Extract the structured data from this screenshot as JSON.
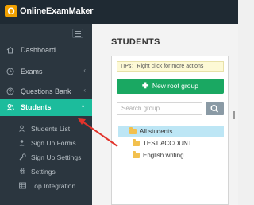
{
  "app": {
    "brand_letter": "O",
    "brand_name": "OnlineExamMaker"
  },
  "sidebar": {
    "items": [
      {
        "label": "Dashboard",
        "icon": "home-icon"
      },
      {
        "label": "Exams",
        "icon": "clock-icon",
        "chevron": "‹"
      },
      {
        "label": "Questions Bank",
        "icon": "question-icon",
        "chevron": "‹"
      },
      {
        "label": "Students",
        "icon": "users-icon",
        "chevron": "⌄",
        "active": true
      }
    ],
    "sub_items": [
      {
        "label": "Students List",
        "icon": "user-list-icon"
      },
      {
        "label": "Sign Up Forms",
        "icon": "user-plus-icon"
      },
      {
        "label": "Sign Up Settings",
        "icon": "wrench-icon"
      },
      {
        "label": "Settings",
        "icon": "gear-icon"
      },
      {
        "label": "Top Integration",
        "icon": "table-icon"
      }
    ]
  },
  "main": {
    "title": "STUDENTS",
    "tips": "TIPs：Right click for more actions",
    "new_root_button": "New root group",
    "search_placeholder": "Search group",
    "tree": [
      {
        "label": "All students",
        "selected": true
      },
      {
        "label": "TEST ACCOUNT"
      },
      {
        "label": "English writing"
      }
    ]
  },
  "colors": {
    "accent": "#1cbc9c",
    "sidebar": "#2b363f",
    "topbar": "#1f2a33",
    "button_green": "#1aa862",
    "annotation_arrow": "#e2332b"
  }
}
